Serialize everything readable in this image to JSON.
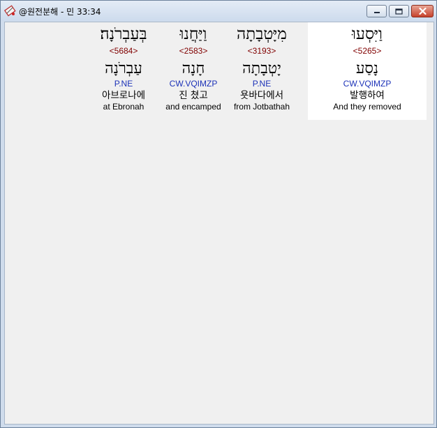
{
  "window": {
    "title": "@원전분해 - 민 33:34"
  },
  "words": [
    {
      "hebrew": "וַיִּסְעוּ",
      "strong": "<5265>",
      "lemma": "נָסַע",
      "morph": "CW.VQIMZP",
      "korean": "발행하여",
      "english": "And they removed"
    },
    {
      "hebrew": "מִיָּטְבָתָה",
      "strong": "<3193>",
      "lemma": "יָטְבָתָה",
      "morph": "P.NE",
      "korean": "욧바다에서",
      "english": "from Jotbathah"
    },
    {
      "hebrew": "וַיַּחֲנוּ",
      "strong": "<2583>",
      "lemma": "חָנָה",
      "morph": "CW.VQIMZP",
      "korean": "진 쳤고",
      "english": "and encamped"
    },
    {
      "hebrew": "בְּעַבְרֹנָה׃",
      "strong": "<5684>",
      "lemma": "עַבְרֹנָה",
      "morph": "P.NE",
      "korean": "아브로나에",
      "english": "at Ebronah"
    }
  ],
  "colors": {
    "strong": "#800000",
    "morph": "#1c32b8",
    "selected_background": "#ffffff"
  },
  "icons": {
    "app": "bible-app-icon",
    "minimize": "minimize-icon",
    "maximize": "maximize-icon",
    "close": "close-icon"
  }
}
